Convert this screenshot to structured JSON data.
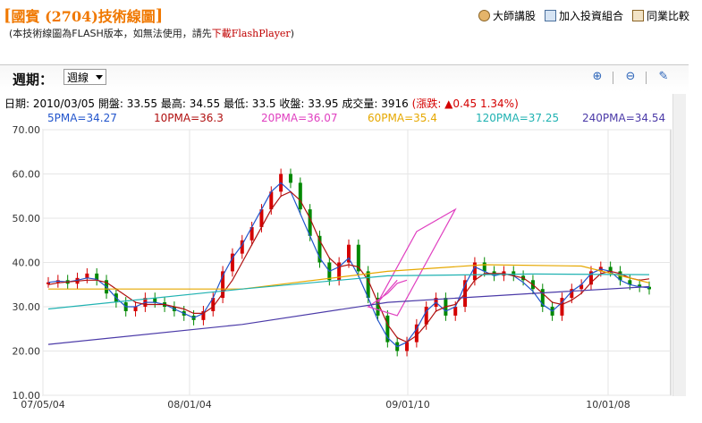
{
  "header": {
    "title": "國賓 (2704)技術線圖",
    "notice_prefix": "(本技術線圖為FLASH版本，如無法使用，請先",
    "notice_link": "下載FlashPlayer",
    "notice_suffix": ")",
    "links": [
      {
        "label": "大師講股",
        "icon": "person-icon"
      },
      {
        "label": "加入投資組合",
        "icon": "portfolio-icon"
      },
      {
        "label": "同業比較",
        "icon": "bar-chart-icon"
      }
    ]
  },
  "controls": {
    "period_label": "週期：",
    "period_value": "週線",
    "tools": [
      "zoom-in-icon",
      "zoom-out-icon",
      "draw-icon"
    ]
  },
  "info_bar": {
    "date": "日期: 2010/03/05",
    "open": "開盤: 33.55",
    "high": "最高: 34.55",
    "low": "最低: 33.5",
    "close": "收盤: 33.95",
    "volume": "成交量: 3916",
    "change": "(漲跌: ▲0.45 1.34%)"
  },
  "ma_legend": [
    {
      "label": "5PMA=34.27",
      "color": "#2255cc"
    },
    {
      "label": "10PMA=36.3",
      "color": "#b01010"
    },
    {
      "label": "20PMA=36.07",
      "color": "#e040c0"
    },
    {
      "label": "60PMA=35.4",
      "color": "#e6a800"
    },
    {
      "label": "120PMA=37.25",
      "color": "#20b2b2"
    },
    {
      "label": "240PMA=34.54",
      "color": "#4b3aa8"
    }
  ],
  "chart_data": {
    "type": "line",
    "title": "",
    "ylim": [
      10,
      70
    ],
    "y_ticks": [
      "70.00",
      "60.00",
      "50.00",
      "40.00",
      "30.00",
      "20.00",
      "10.00"
    ],
    "x_ticks": [
      "07/05/04",
      "08/01/04",
      "09/01/10",
      "10/01/08"
    ],
    "candles_close_approx": [
      35.5,
      36,
      35.2,
      36.5,
      37.5,
      36,
      33,
      31,
      29,
      30,
      32,
      31,
      30,
      29,
      28,
      27,
      29,
      32,
      38,
      42,
      45,
      48,
      52,
      56,
      60,
      58,
      52,
      46,
      40,
      36,
      40,
      44,
      38,
      32,
      28,
      22,
      20,
      22,
      26,
      30,
      32,
      28,
      30,
      36,
      40,
      38,
      37,
      38,
      37,
      36,
      34,
      30,
      28,
      32,
      34,
      35,
      38,
      39,
      38,
      36,
      35,
      34.5,
      33.95
    ],
    "series": [
      {
        "name": "5PMA",
        "values": [
          35.5,
          35.8,
          35.6,
          36,
          36.5,
          36.2,
          34.5,
          32,
          30,
          30,
          31,
          31,
          30.5,
          29.5,
          28.5,
          27.5,
          28.5,
          32,
          37,
          41,
          44,
          48,
          52,
          56,
          58,
          56,
          51,
          46,
          41,
          38,
          39,
          41,
          37,
          32,
          27,
          23,
          21,
          22,
          25,
          29,
          31,
          29,
          30,
          35,
          39,
          38,
          37,
          37.5,
          37,
          35.5,
          33.5,
          30.5,
          29,
          31,
          33.5,
          35,
          37.5,
          38.5,
          38,
          36,
          35,
          34.5,
          34.27
        ]
      },
      {
        "name": "10PMA",
        "values": [
          35,
          35.4,
          35.6,
          35.8,
          36,
          36,
          35.5,
          34,
          32.5,
          31,
          30.5,
          30.5,
          30.5,
          30,
          29.5,
          28.5,
          28.5,
          30,
          33,
          36,
          40,
          44,
          48,
          52,
          55,
          56,
          54,
          50,
          45,
          41,
          39,
          39.5,
          39,
          36,
          31,
          26,
          23,
          22,
          23.5,
          26,
          29,
          30,
          30.5,
          33,
          36,
          37.5,
          37.5,
          37.5,
          37,
          36.5,
          35,
          33,
          31,
          30.5,
          31.5,
          33,
          35.5,
          37.5,
          38,
          37.5,
          36.5,
          36,
          36.3
        ]
      }
    ]
  }
}
